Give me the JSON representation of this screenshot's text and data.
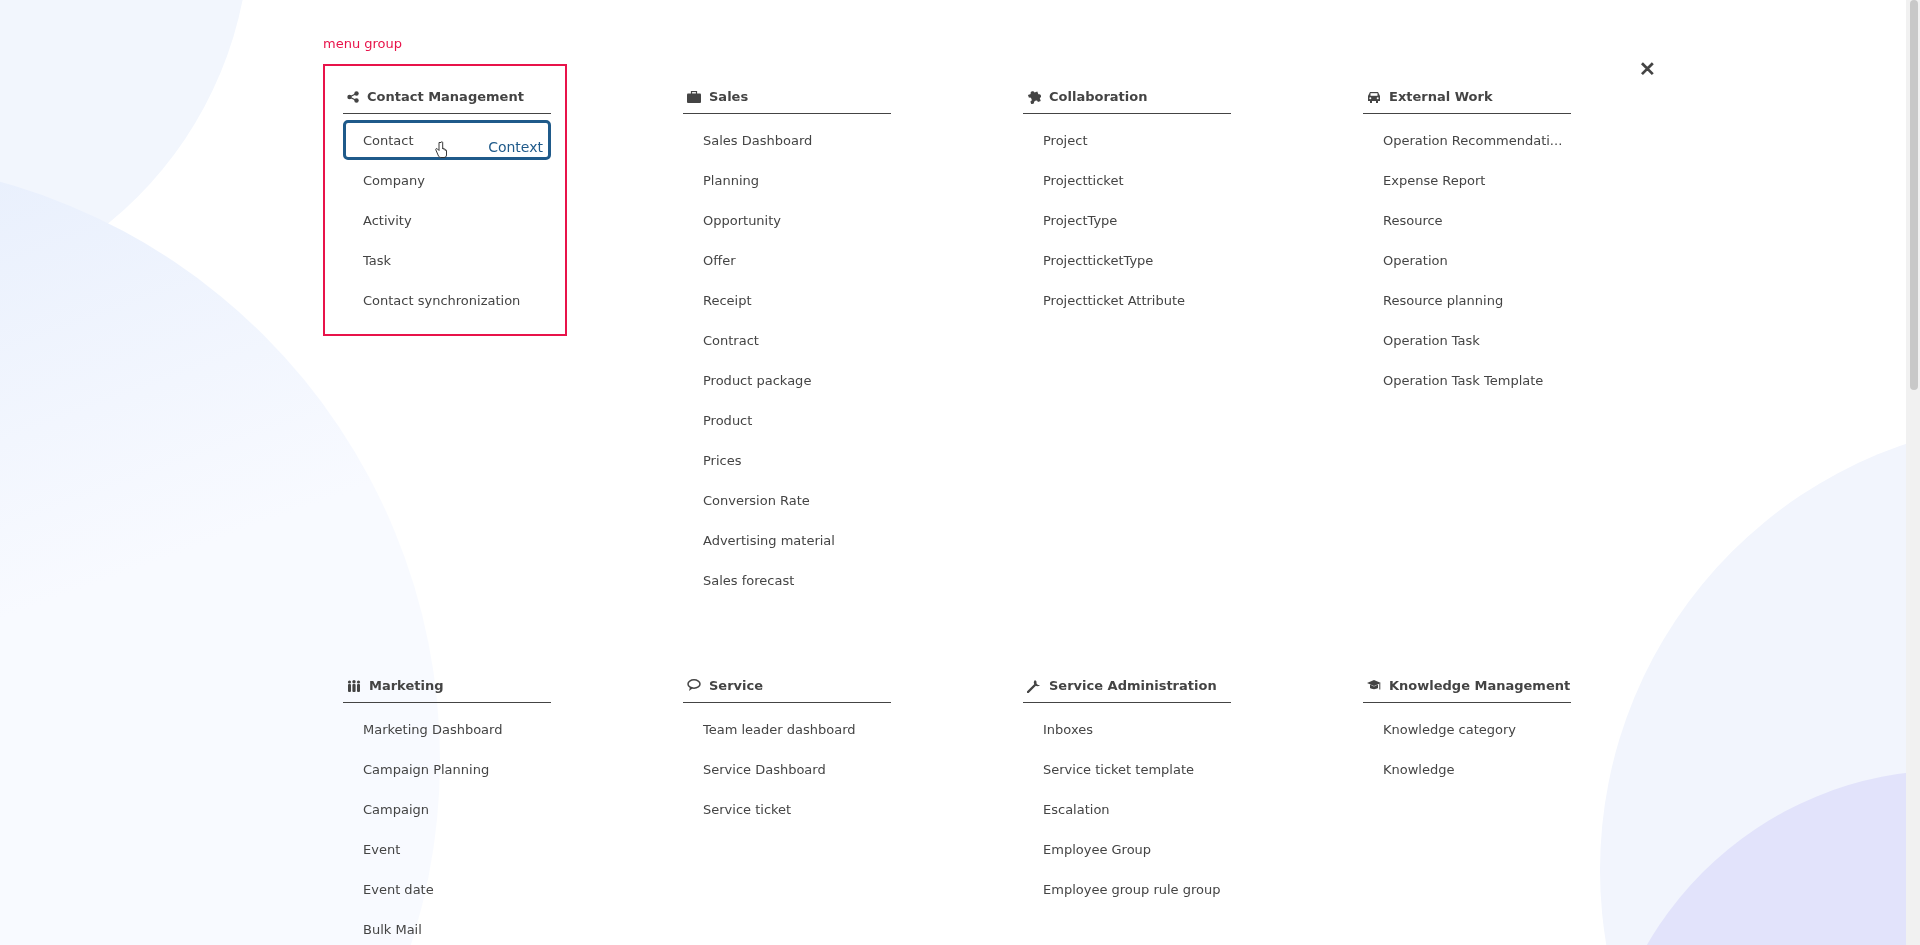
{
  "close_button": {
    "label": "✕"
  },
  "groups": [
    {
      "title": "Contact Management",
      "annotation": "menu group",
      "items": [
        {
          "label": "Contact",
          "highlighted": true,
          "context_label": "Context"
        },
        {
          "label": "Company",
          "highlighted": false
        },
        {
          "label": "Activity",
          "highlighted": false
        },
        {
          "label": "Task",
          "highlighted": false
        },
        {
          "label": "Contact synchronization",
          "highlighted": false
        }
      ]
    },
    {
      "title": "Sales",
      "items": [
        {
          "label": "Sales Dashboard",
          "highlighted": false
        },
        {
          "label": "Planning",
          "highlighted": false
        },
        {
          "label": "Opportunity",
          "highlighted": false
        },
        {
          "label": "Offer",
          "highlighted": false
        },
        {
          "label": "Receipt",
          "highlighted": false
        },
        {
          "label": "Contract",
          "highlighted": false
        },
        {
          "label": "Product package",
          "highlighted": false
        },
        {
          "label": "Product",
          "highlighted": false
        },
        {
          "label": "Prices",
          "highlighted": false
        },
        {
          "label": "Conversion Rate",
          "highlighted": false
        },
        {
          "label": "Advertising material",
          "highlighted": false
        },
        {
          "label": "Sales forecast",
          "highlighted": false
        }
      ]
    },
    {
      "title": "Collaboration",
      "items": [
        {
          "label": "Project",
          "highlighted": false
        },
        {
          "label": "Projectticket",
          "highlighted": false
        },
        {
          "label": "ProjectType",
          "highlighted": false
        },
        {
          "label": "ProjectticketType",
          "highlighted": false
        },
        {
          "label": "Projectticket Attribute",
          "highlighted": false
        }
      ]
    },
    {
      "title": "External Work",
      "items": [
        {
          "label": "Operation Recommendati...",
          "highlighted": false
        },
        {
          "label": "Expense Report",
          "highlighted": false
        },
        {
          "label": "Resource",
          "highlighted": false
        },
        {
          "label": "Operation",
          "highlighted": false
        },
        {
          "label": "Resource planning",
          "highlighted": false
        },
        {
          "label": "Operation Task",
          "highlighted": false
        },
        {
          "label": "Operation Task Template",
          "highlighted": false
        }
      ]
    },
    {
      "title": "Marketing",
      "items": [
        {
          "label": "Marketing Dashboard",
          "highlighted": false
        },
        {
          "label": "Campaign Planning",
          "highlighted": false
        },
        {
          "label": "Campaign",
          "highlighted": false
        },
        {
          "label": "Event",
          "highlighted": false
        },
        {
          "label": "Event date",
          "highlighted": false
        },
        {
          "label": "Bulk Mail",
          "highlighted": false
        }
      ]
    },
    {
      "title": "Service",
      "items": [
        {
          "label": "Team leader dashboard",
          "highlighted": false
        },
        {
          "label": "Service Dashboard",
          "highlighted": false
        },
        {
          "label": "Service ticket",
          "highlighted": false
        }
      ]
    },
    {
      "title": "Service Administration",
      "items": [
        {
          "label": "Inboxes",
          "highlighted": false
        },
        {
          "label": "Service ticket template",
          "highlighted": false
        },
        {
          "label": "Escalation",
          "highlighted": false
        },
        {
          "label": "Employee Group",
          "highlighted": false
        },
        {
          "label": "Employee group rule group",
          "highlighted": false
        }
      ]
    },
    {
      "title": "Knowledge Management",
      "items": [
        {
          "label": "Knowledge category",
          "highlighted": false
        },
        {
          "label": "Knowledge",
          "highlighted": false
        }
      ]
    }
  ]
}
